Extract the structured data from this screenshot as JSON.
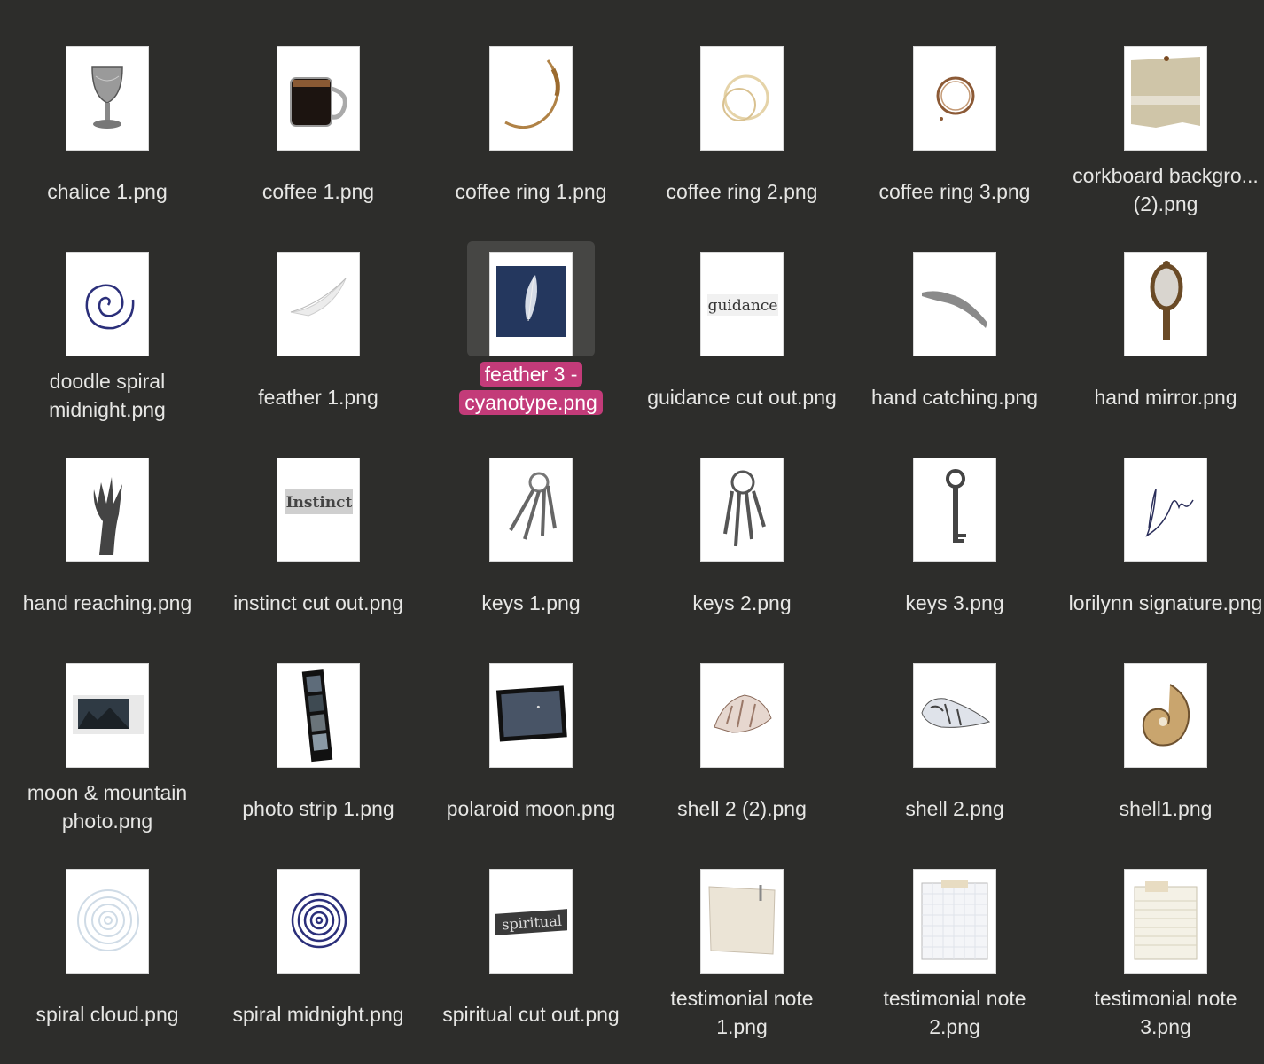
{
  "window": {
    "view": "icon-view"
  },
  "files": [
    {
      "name": "chalice 1.png",
      "icon": "chalice-icon"
    },
    {
      "name": "coffee 1.png",
      "icon": "coffee-mug-icon"
    },
    {
      "name": "coffee ring 1.png",
      "icon": "coffee-ring-icon"
    },
    {
      "name": "coffee ring 2.png",
      "icon": "coffee-ring-icon"
    },
    {
      "name": "coffee ring 3.png",
      "icon": "coffee-ring-icon"
    },
    {
      "name": "corkboard backgro...(2).png",
      "icon": "corkboard-icon"
    },
    {
      "name": "doodle spiral midnight.png",
      "icon": "spiral-icon"
    },
    {
      "name": "feather 1.png",
      "icon": "feather-icon"
    },
    {
      "name": "feather 3 - cyanotype.png",
      "icon": "cyanotype-feather-icon",
      "selected": true
    },
    {
      "name": "guidance cut out.png",
      "icon": "word-cutout-icon",
      "word": "guidance"
    },
    {
      "name": "hand catching.png",
      "icon": "hand-catching-icon"
    },
    {
      "name": "hand mirror.png",
      "icon": "hand-mirror-icon"
    },
    {
      "name": "hand reaching.png",
      "icon": "hand-reaching-icon"
    },
    {
      "name": "instinct cut out.png",
      "icon": "word-cutout-icon",
      "word": "Instinct"
    },
    {
      "name": "keys 1.png",
      "icon": "keys-icon"
    },
    {
      "name": "keys 2.png",
      "icon": "keys-icon"
    },
    {
      "name": "keys 3.png",
      "icon": "key-icon"
    },
    {
      "name": "lorilynn signature.png",
      "icon": "signature-icon"
    },
    {
      "name": "moon & mountain photo.png",
      "icon": "photo-icon"
    },
    {
      "name": "photo strip 1.png",
      "icon": "photo-strip-icon"
    },
    {
      "name": "polaroid moon.png",
      "icon": "polaroid-icon"
    },
    {
      "name": "shell 2 (2).png",
      "icon": "conch-shell-icon"
    },
    {
      "name": "shell 2.png",
      "icon": "spiral-shell-icon"
    },
    {
      "name": "shell1.png",
      "icon": "nautilus-shell-icon"
    },
    {
      "name": "spiral cloud.png",
      "icon": "spiral-cloud-icon"
    },
    {
      "name": "spiral midnight.png",
      "icon": "spiral-icon"
    },
    {
      "name": "spiritual cut out.png",
      "icon": "word-cutout-icon",
      "word": "spiritual"
    },
    {
      "name": "testimonial note 1.png",
      "icon": "note-paper-icon"
    },
    {
      "name": "testimonial note 2.png",
      "icon": "grid-note-icon"
    },
    {
      "name": "testimonial note 3.png",
      "icon": "lined-note-icon"
    }
  ],
  "colors": {
    "background": "#2d2d2b",
    "label": "#e6e6e4",
    "selection": "#c33b79",
    "selected_thumb_bg": "#464644"
  }
}
